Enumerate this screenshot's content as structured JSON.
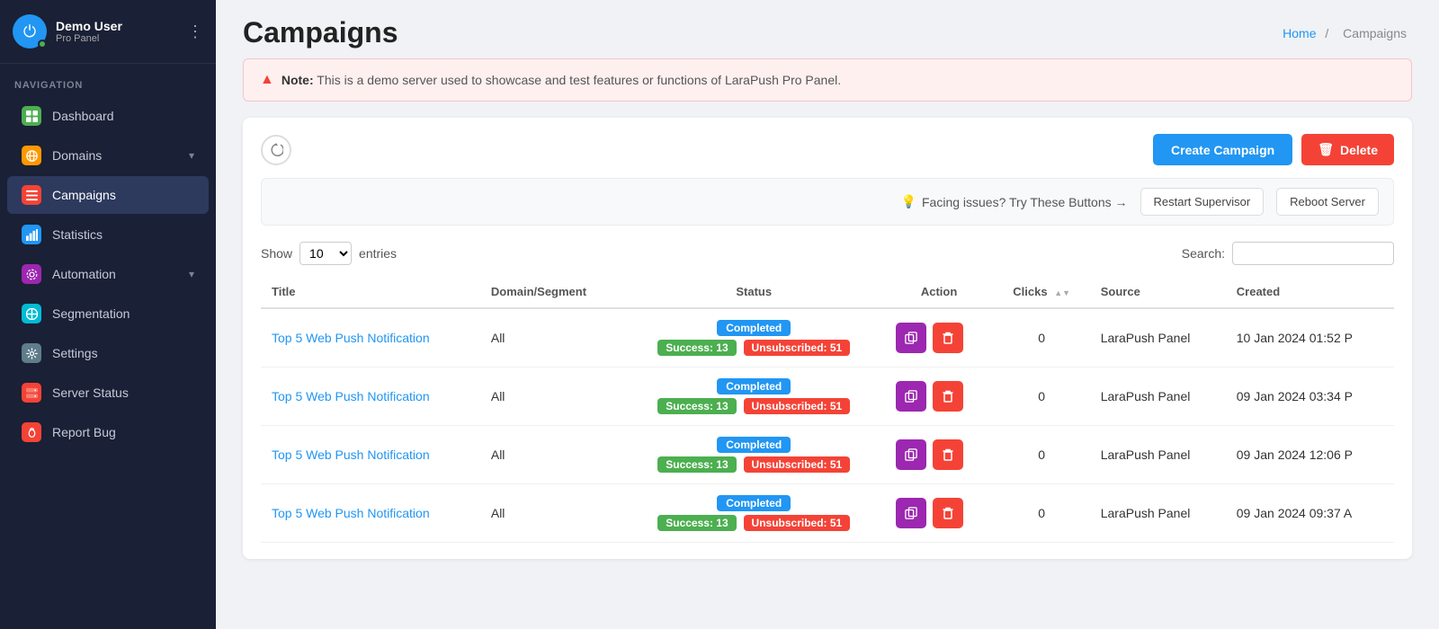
{
  "sidebar": {
    "user": {
      "name": "Demo User",
      "role": "Pro Panel",
      "avatar_icon": "⏻"
    },
    "section_label": "Navigation",
    "items": [
      {
        "id": "dashboard",
        "label": "Dashboard",
        "icon": "⊞",
        "icon_class": "icon-dashboard",
        "active": false,
        "has_chevron": false
      },
      {
        "id": "domains",
        "label": "Domains",
        "icon": "🌐",
        "icon_class": "icon-domains",
        "active": false,
        "has_chevron": true
      },
      {
        "id": "campaigns",
        "label": "Campaigns",
        "icon": "≡",
        "icon_class": "icon-campaigns",
        "active": true,
        "has_chevron": false
      },
      {
        "id": "statistics",
        "label": "Statistics",
        "icon": "📊",
        "icon_class": "icon-statistics",
        "active": false,
        "has_chevron": false
      },
      {
        "id": "automation",
        "label": "Automation",
        "icon": "⚙",
        "icon_class": "icon-automation",
        "active": false,
        "has_chevron": true
      },
      {
        "id": "segmentation",
        "label": "Segmentation",
        "icon": "⊕",
        "icon_class": "icon-segmentation",
        "active": false,
        "has_chevron": false
      },
      {
        "id": "settings",
        "label": "Settings",
        "icon": "⚙",
        "icon_class": "icon-settings",
        "active": false,
        "has_chevron": false
      },
      {
        "id": "server-status",
        "label": "Server Status",
        "icon": "≡",
        "icon_class": "icon-server",
        "active": false,
        "has_chevron": false
      },
      {
        "id": "report-bug",
        "label": "Report Bug",
        "icon": "🐛",
        "icon_class": "icon-bug",
        "active": false,
        "has_chevron": false
      }
    ]
  },
  "header": {
    "title": "Campaigns",
    "breadcrumb_home": "Home",
    "breadcrumb_separator": "/",
    "breadcrumb_current": "Campaigns"
  },
  "alert": {
    "icon": "▲",
    "bold_text": "Note:",
    "text": " This is a demo server used to showcase and test features or functions of LaraPush Pro Panel."
  },
  "toolbar": {
    "refresh_title": "Refresh",
    "create_label": "Create Campaign",
    "delete_label": "Delete",
    "delete_icon": "🗑"
  },
  "issues_bar": {
    "icon": "💡",
    "text": "Facing issues? Try These Buttons →",
    "restart_label": "Restart Supervisor",
    "reboot_label": "Reboot Server"
  },
  "table": {
    "show_label": "Show",
    "entries_label": "entries",
    "entries_value": "10",
    "search_label": "Search:",
    "search_value": "",
    "search_placeholder": "",
    "columns": [
      {
        "id": "title",
        "label": "Title"
      },
      {
        "id": "domain",
        "label": "Domain/Segment"
      },
      {
        "id": "status",
        "label": "Status"
      },
      {
        "id": "action",
        "label": "Action"
      },
      {
        "id": "clicks",
        "label": "Clicks"
      },
      {
        "id": "source",
        "label": "Source"
      },
      {
        "id": "created",
        "label": "Created"
      }
    ],
    "rows": [
      {
        "title": "Top 5 Web Push Notification",
        "domain": "All",
        "status_badge": "Completed",
        "success": "Success: 13",
        "unsub": "Unsubscribed: 51",
        "clicks": "0",
        "source": "LaraPush Panel",
        "created": "10 Jan 2024 01:52 P"
      },
      {
        "title": "Top 5 Web Push Notification",
        "domain": "All",
        "status_badge": "Completed",
        "success": "Success: 13",
        "unsub": "Unsubscribed: 51",
        "clicks": "0",
        "source": "LaraPush Panel",
        "created": "09 Jan 2024 03:34 P"
      },
      {
        "title": "Top 5 Web Push Notification",
        "domain": "All",
        "status_badge": "Completed",
        "success": "Success: 13",
        "unsub": "Unsubscribed: 51",
        "clicks": "0",
        "source": "LaraPush Panel",
        "created": "09 Jan 2024 12:06 P"
      },
      {
        "title": "Top 5 Web Push Notification",
        "domain": "All",
        "status_badge": "Completed",
        "success": "Success: 13",
        "unsub": "Unsubscribed: 51",
        "clicks": "0",
        "source": "LaraPush Panel",
        "created": "09 Jan 2024 09:37 A"
      }
    ]
  }
}
